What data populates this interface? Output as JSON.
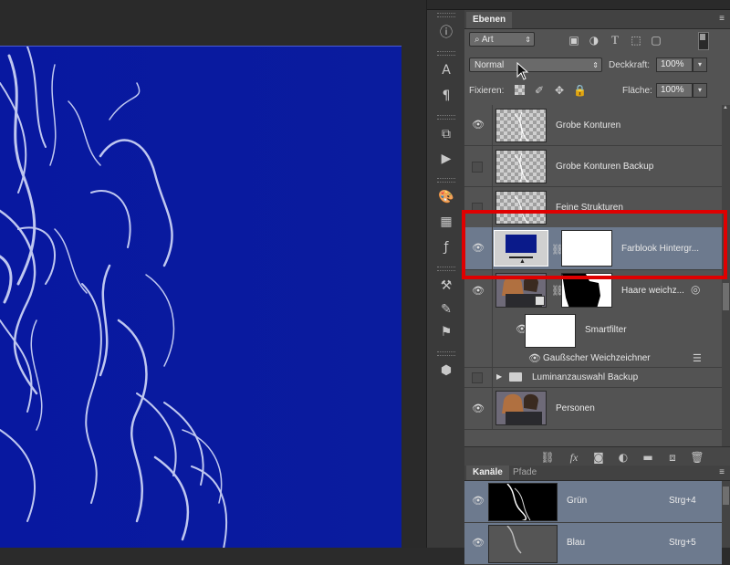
{
  "layers_panel": {
    "tabs": [
      "Ebenen"
    ],
    "filter": {
      "label": "Art"
    },
    "filter_icons": [
      "image-filter-icon",
      "adjustment-filter-icon",
      "type-filter-icon",
      "shape-filter-icon",
      "smart-object-filter-icon"
    ],
    "blend_mode": "Normal",
    "opacity_label": "Deckkraft:",
    "opacity_value": "100%",
    "lock_label": "Fixieren:",
    "fill_label": "Fläche:",
    "fill_value": "100%",
    "layers": [
      {
        "name": "Grobe Konturen",
        "visible": true
      },
      {
        "name": "Grobe Konturen Backup",
        "visible": false
      },
      {
        "name": "Feine Strukturen",
        "visible": false
      },
      {
        "name": "Farblook Hintergr...",
        "visible": true,
        "selected": true
      },
      {
        "name": "Haare weichz...",
        "visible": true
      },
      {
        "name": "Smartfilter",
        "visible": true
      },
      {
        "name": "Gaußscher Weichzeichner",
        "visible": true
      },
      {
        "name": "Luminanzauswahl Backup",
        "visible": false,
        "type": "group"
      },
      {
        "name": "Personen",
        "visible": true
      }
    ],
    "bottom_icons": [
      "link-layers-icon",
      "fx-icon",
      "add-mask-icon",
      "adjustment-layer-icon",
      "new-group-icon",
      "new-layer-icon",
      "trash-icon"
    ]
  },
  "channels_panel": {
    "tabs": [
      "Kanäle",
      "Pfade"
    ],
    "channels": [
      {
        "name": "Grün",
        "shortcut": "Strg+4"
      },
      {
        "name": "Blau",
        "shortcut": "Strg+5"
      }
    ]
  },
  "colors": {
    "canvas_blue": "#0a1a9a",
    "highlight_red": "#e00000",
    "selected_row": "#6d7a8e"
  }
}
